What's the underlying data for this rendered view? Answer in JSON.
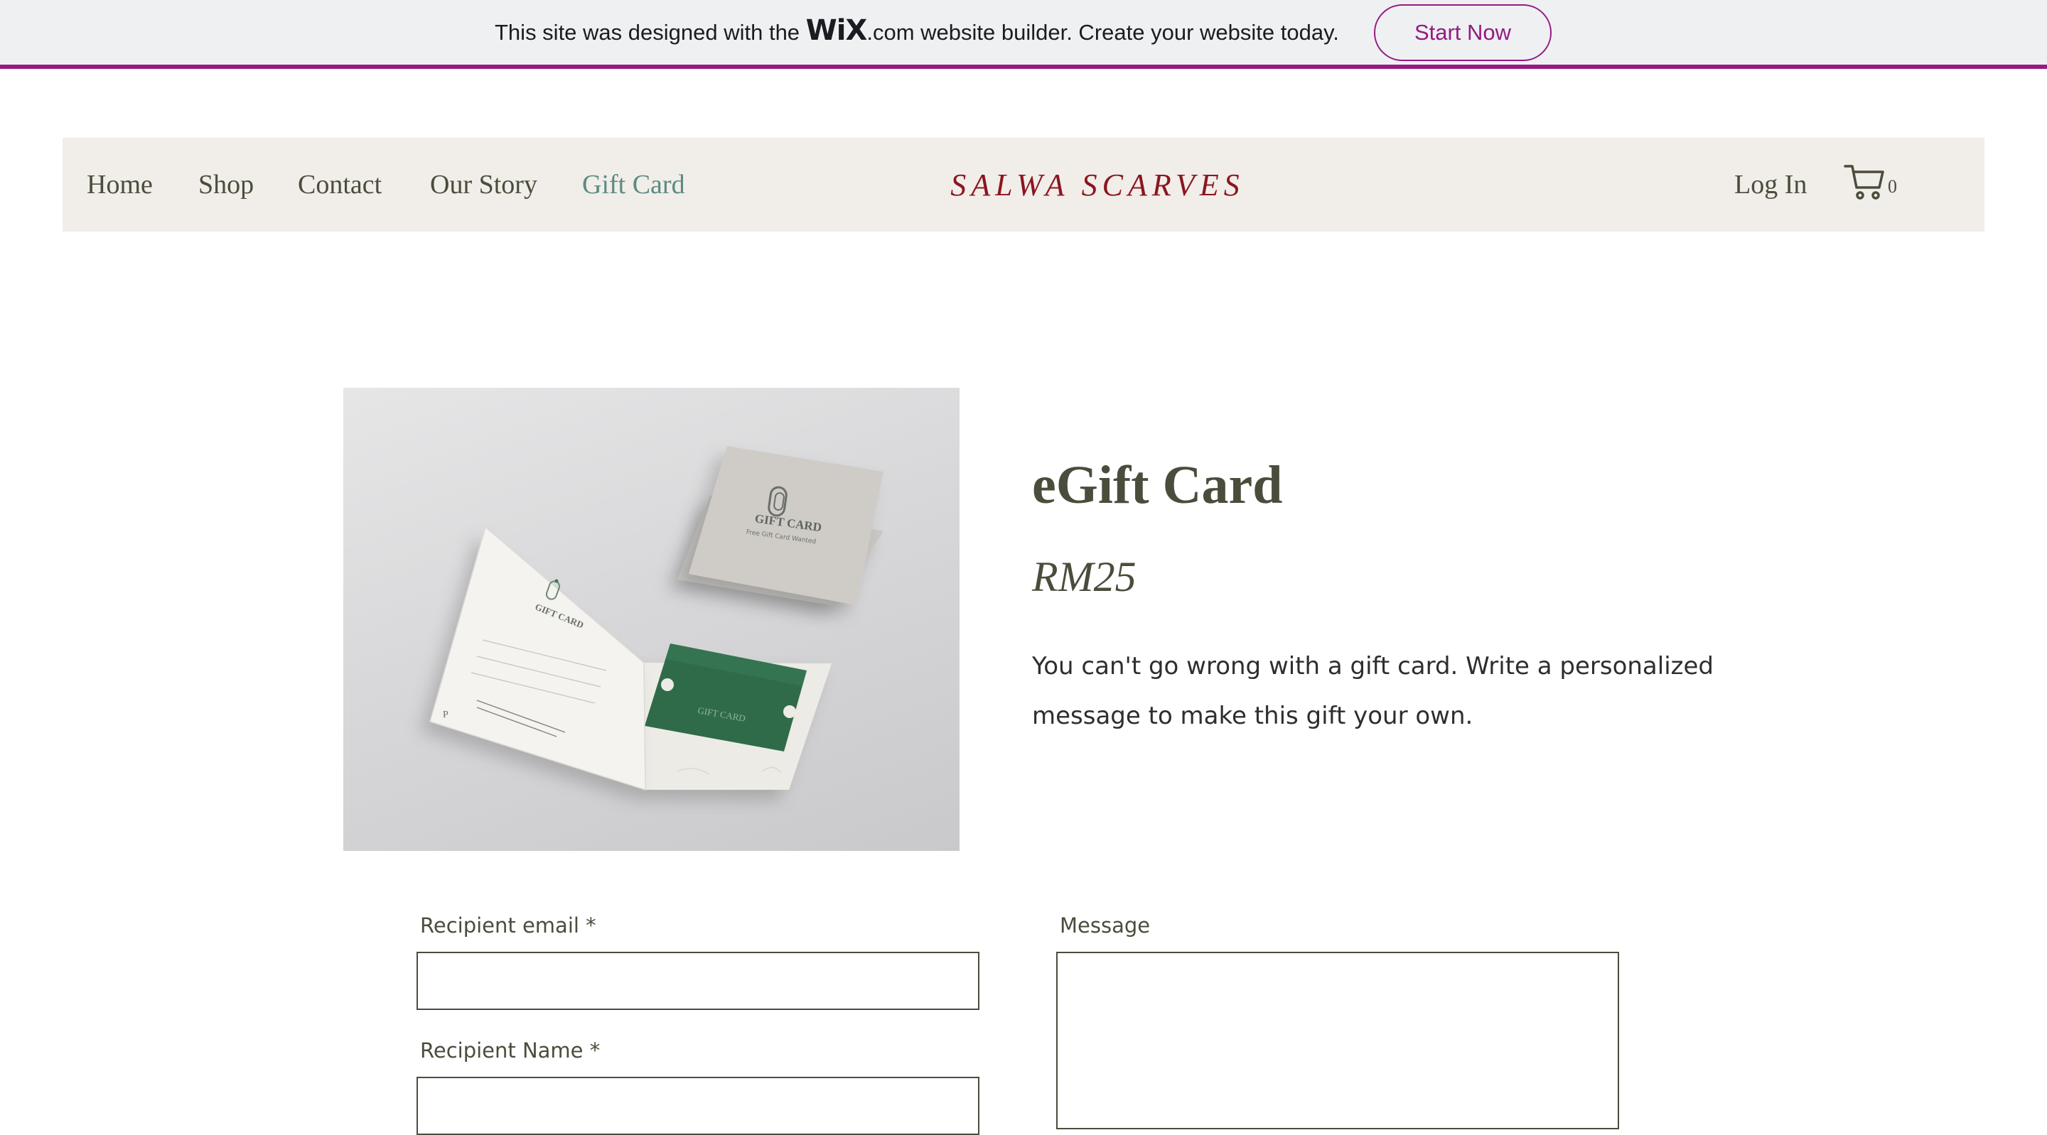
{
  "wix_banner": {
    "text_before": "This site was designed with the ",
    "logo_text": "WiX",
    "text_after": ".com website builder. Create your website today.",
    "button_label": "Start Now",
    "accent_color": "#951b81"
  },
  "header": {
    "nav": [
      {
        "label": "Home"
      },
      {
        "label": "Shop"
      },
      {
        "label": "Contact"
      },
      {
        "label": "Our Story"
      },
      {
        "label": "Gift Card",
        "active": true
      }
    ],
    "brand": "SALWA SCARVES",
    "login_label": "Log In",
    "cart_icon": "cart-icon",
    "cart_count": "0",
    "brand_color": "#8b1520"
  },
  "product": {
    "title": "eGift Card",
    "price": "RM25",
    "description": "You can't go wrong with a gift card. Write a personalized message to make this gift your own.",
    "image_texts": {
      "card_title": "GIFT CARD",
      "card_subtitle": "Free Gift Card Wanted"
    }
  },
  "form": {
    "recipient_email_label": "Recipient email *",
    "recipient_email_value": "",
    "recipient_name_label": "Recipient Name *",
    "recipient_name_value": "",
    "message_label": "Message",
    "message_value": ""
  }
}
